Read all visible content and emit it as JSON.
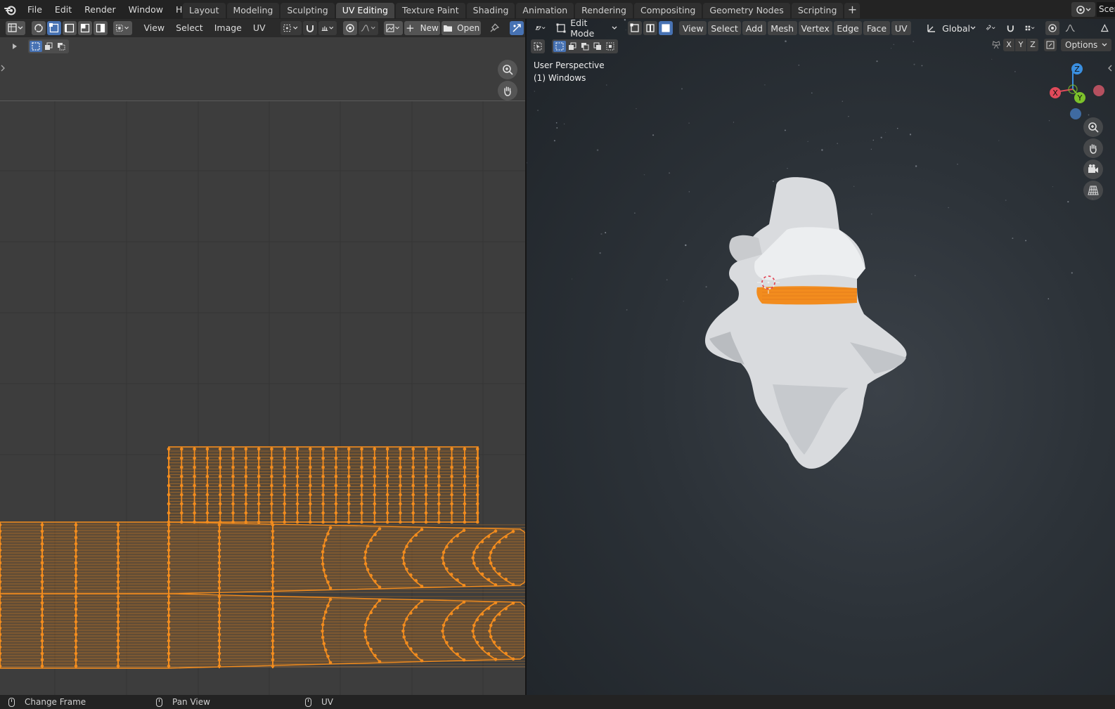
{
  "menubar": {
    "items": [
      "File",
      "Edit",
      "Render",
      "Window",
      "Help"
    ],
    "workspaces": [
      "Layout",
      "Modeling",
      "Sculpting",
      "UV Editing",
      "Texture Paint",
      "Shading",
      "Animation",
      "Rendering",
      "Compositing",
      "Geometry Nodes",
      "Scripting"
    ],
    "active_workspace": "UV Editing",
    "add_label": "+",
    "scene_label": "Scen"
  },
  "uv_editor": {
    "menus": [
      "View",
      "Select",
      "Image",
      "UV"
    ],
    "new_label": "New",
    "open_label": "Open",
    "plus_glyph": "+"
  },
  "viewport": {
    "mode": "Edit Mode",
    "menus": [
      "View",
      "Select",
      "Add",
      "Mesh",
      "Vertex",
      "Edge",
      "Face",
      "UV"
    ],
    "transform_orientation": "Global",
    "options_label": "Options",
    "axes": [
      "X",
      "Y",
      "Z"
    ],
    "view_name": "User Perspective",
    "object_info": "(1) Windows",
    "gizmo": {
      "x": "X",
      "y": "Y",
      "z": "Z"
    }
  },
  "statusbar": {
    "items": [
      "Change Frame",
      "Pan View",
      "UV"
    ]
  },
  "colors": {
    "selection_orange": "#f28c1e",
    "active_blue": "#4772b3",
    "axis_x": "#e04a5a",
    "axis_y": "#7cc22b",
    "axis_z": "#3a8fe0"
  }
}
